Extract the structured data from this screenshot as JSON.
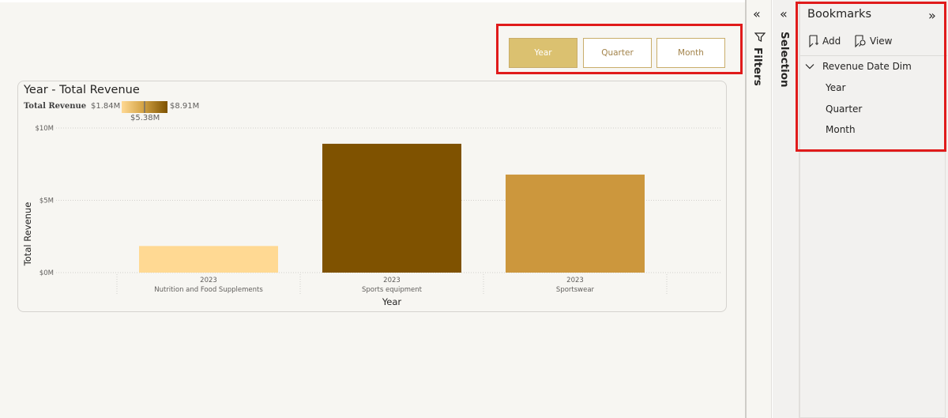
{
  "slicer": {
    "buttons": [
      {
        "label": "Year",
        "active": true
      },
      {
        "label": "Quarter",
        "active": false
      },
      {
        "label": "Month",
        "active": false
      }
    ]
  },
  "chart_card": {
    "title": "Year - Total Revenue",
    "legend": {
      "label": "Total Revenue",
      "min": "$1.84M",
      "mid": "$5.38M",
      "max": "$8.91M"
    }
  },
  "chart_data": {
    "type": "bar",
    "title": "Year - Total Revenue",
    "xlabel": "Year",
    "ylabel": "Total Revenue",
    "ylim": [
      0,
      10000000
    ],
    "yticks": [
      {
        "value": 0,
        "label": "$0M"
      },
      {
        "value": 5000000,
        "label": "$5M"
      },
      {
        "value": 10000000,
        "label": "$10M"
      }
    ],
    "grid": true,
    "categories": [
      {
        "year": "2023",
        "name": "Nutrition and Food Supplements"
      },
      {
        "year": "2023",
        "name": "Sports equipment"
      },
      {
        "year": "2023",
        "name": "Sportswear"
      }
    ],
    "values": [
      1840000,
      8910000,
      6780000
    ],
    "colors": [
      "#ffd993",
      "#7f5200",
      "#cc973d"
    ],
    "color_scale": {
      "min": 1840000,
      "mid": 5380000,
      "max": 8910000,
      "min_color": "#ffd993",
      "max_color": "#7d5200"
    }
  },
  "panes": {
    "filters": {
      "label": "Filters",
      "collapse_icon": "double-chevron-left",
      "icon": "filter-icon"
    },
    "selection": {
      "label": "Selection",
      "collapse_icon": "double-chevron-left"
    }
  },
  "bookmarks": {
    "title": "Bookmarks",
    "collapse_glyph": "»",
    "add_label": "Add",
    "view_label": "View",
    "group": "Revenue Date Dim",
    "items": [
      "Year",
      "Quarter",
      "Month"
    ]
  },
  "glyphs": {
    "double_left": "«",
    "double_right": "»"
  }
}
